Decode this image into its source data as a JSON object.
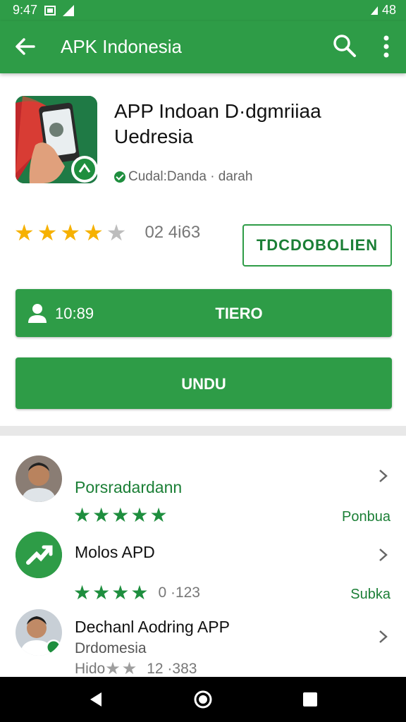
{
  "status_bar": {
    "time": "9:47",
    "battery": "48"
  },
  "app_bar": {
    "title": "APK Indonesia",
    "back_icon": "arrow-left-icon",
    "search_icon": "search-icon",
    "more_icon": "more-vert-icon"
  },
  "app": {
    "title_line1": "APP Indoan D·dgmriiaa",
    "title_line2": "Uedresia",
    "subtitle": "Cudal:Danda · darah",
    "rating": 4,
    "rating_count": "02 4i63",
    "install_label": "TDCDOBOLIEN",
    "btn1_count": "10:89",
    "btn1_label": "TIERO",
    "btn2_label": "UNDU"
  },
  "list": [
    {
      "title": "Porsradardann",
      "stars": 5,
      "count": "",
      "tag": "Ponbua"
    },
    {
      "title": "Molos APD",
      "stars": 4,
      "count": "0 ·123",
      "tag": "Subka"
    },
    {
      "title": "Dechanl Aodring APP",
      "subtitle": "Drdomesia",
      "stars_prefix": "Hido",
      "count": "12 ·383"
    }
  ],
  "colors": {
    "primary": "#2e9c47",
    "star": "#f6b100",
    "nav": "#000000"
  }
}
